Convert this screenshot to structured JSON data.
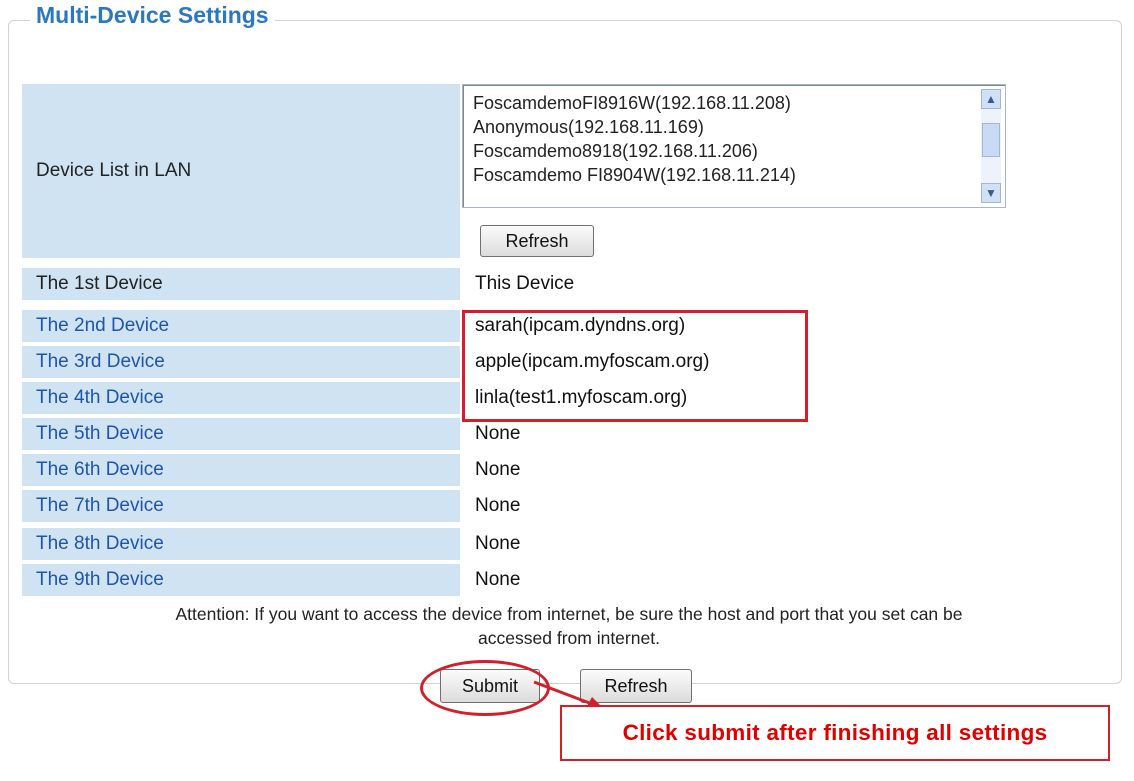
{
  "section": {
    "title": "Multi-Device Settings"
  },
  "device_list": {
    "label": "Device List in LAN",
    "items": [
      "FoscamdemoFI8916W(192.168.11.208)",
      "Anonymous(192.168.11.169)",
      "Foscamdemo8918(192.168.11.206)",
      "Foscamdemo FI8904W(192.168.11.214)"
    ],
    "refresh_label": "Refresh"
  },
  "devices": [
    {
      "label": "The 1st Device",
      "value": "This Device"
    },
    {
      "label": "The 2nd Device",
      "value": "sarah(ipcam.dyndns.org)"
    },
    {
      "label": "The 3rd Device",
      "value": "apple(ipcam.myfoscam.org)"
    },
    {
      "label": "The 4th Device",
      "value": "linla(test1.myfoscam.org)"
    },
    {
      "label": "The 5th Device",
      "value": "None"
    },
    {
      "label": "The 6th Device",
      "value": "None"
    },
    {
      "label": "The 7th Device",
      "value": "None"
    },
    {
      "label": "The 8th Device",
      "value": "None"
    },
    {
      "label": "The 9th Device",
      "value": "None"
    }
  ],
  "attention": {
    "line1": "Attention: If you want to access the device from internet, be sure the host and port that you set can be",
    "line2": "accessed from internet."
  },
  "buttons": {
    "submit": "Submit",
    "refresh": "Refresh"
  },
  "callout": {
    "text": "Click submit after finishing all settings"
  },
  "colors": {
    "accent": "#2b78c2",
    "label_bg": "#cfe3f3",
    "highlight": "#d21f2a"
  }
}
